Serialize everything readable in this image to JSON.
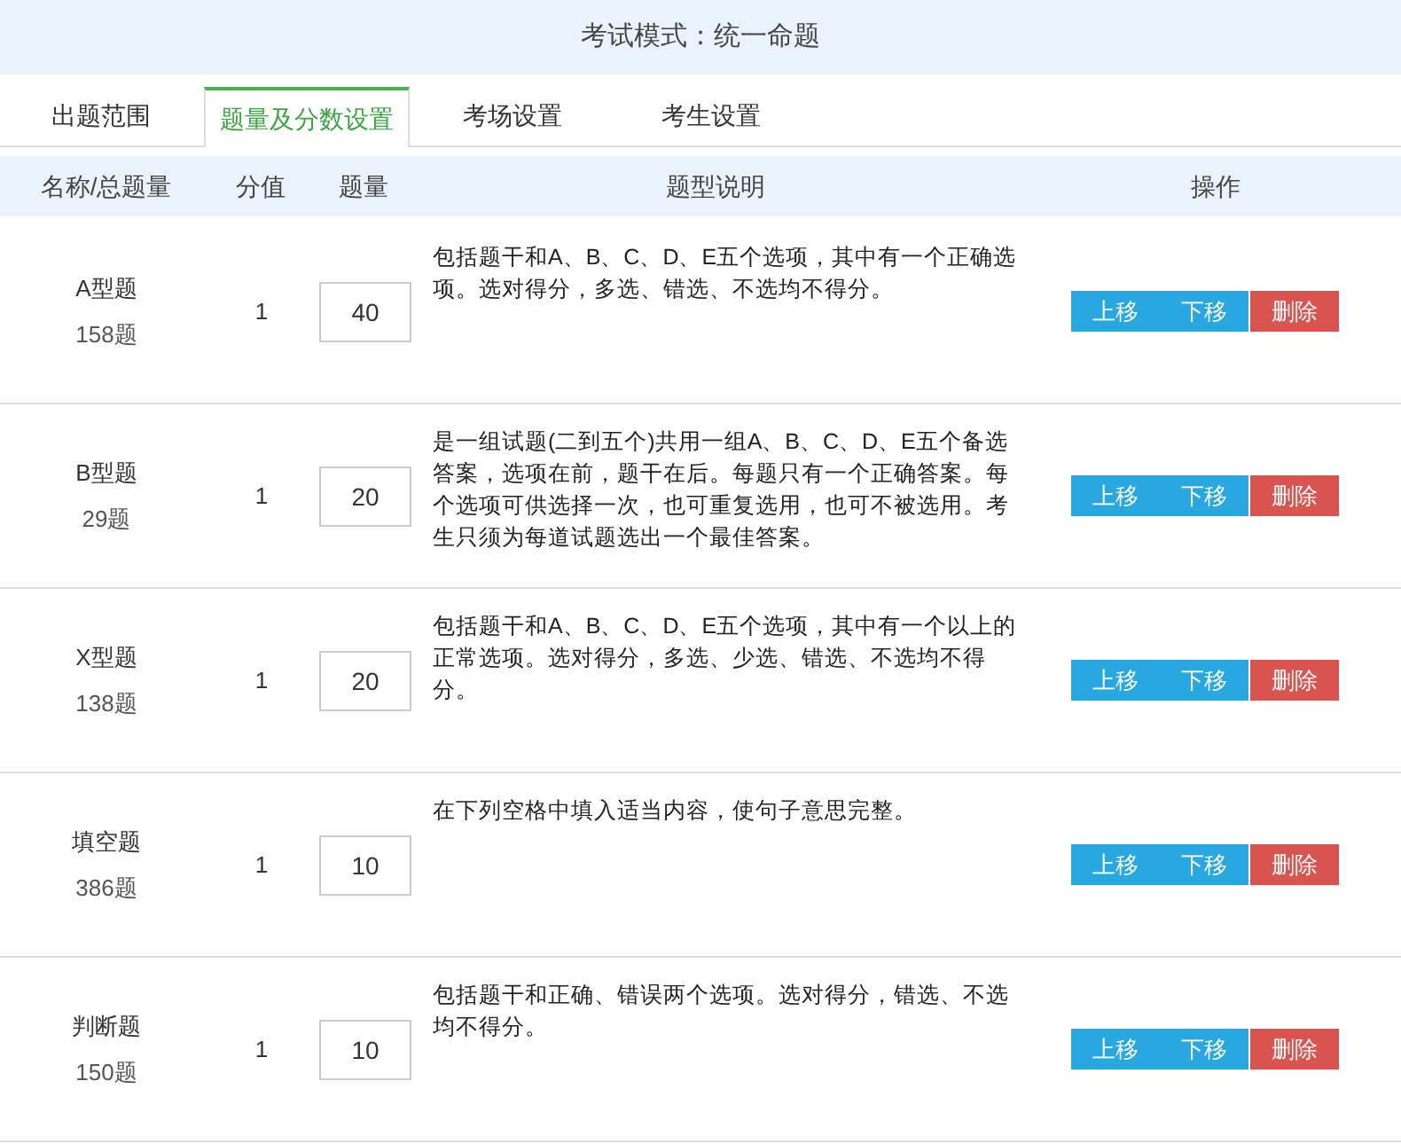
{
  "header": {
    "title": "考试模式：统一命题"
  },
  "tabs": [
    {
      "label": "出题范围",
      "selected": false
    },
    {
      "label": "题量及分数设置",
      "selected": true
    },
    {
      "label": "考场设置",
      "selected": false
    },
    {
      "label": "考生设置",
      "selected": false
    }
  ],
  "table": {
    "columns": [
      "名称/总题量",
      "分值",
      "题量",
      "题型说明",
      "操作"
    ],
    "rows": [
      {
        "name": "A型题",
        "total": "158题",
        "score": "1",
        "count": "40",
        "description": "包括题干和A、B、C、D、E五个选项，其中有一个正确选项。选对得分，多选、错选、不选均不得分。",
        "actions": [
          "上移",
          "下移",
          "删除"
        ]
      },
      {
        "name": "B型题",
        "total": "29题",
        "score": "1",
        "count": "20",
        "description": "是一组试题(二到五个)共用一组A、B、C、D、E五个备选答案，选项在前，题干在后。每题只有一个正确答案。每个选项可供选择一次，也可重复选用，也可不被选用。考生只须为每道试题选出一个最佳答案。",
        "actions": [
          "上移",
          "下移",
          "删除"
        ]
      },
      {
        "name": "X型题",
        "total": "138题",
        "score": "1",
        "count": "20",
        "description": "包括题干和A、B、C、D、E五个选项，其中有一个以上的正常选项。选对得分，多选、少选、错选、不选均不得分。",
        "actions": [
          "上移",
          "下移",
          "删除"
        ]
      },
      {
        "name": "填空题",
        "total": "386题",
        "score": "1",
        "count": "10",
        "description": "在下列空格中填入适当内容，使句子意思完整。",
        "actions": [
          "上移",
          "下移",
          "删除"
        ]
      },
      {
        "name": "判断题",
        "total": "150题",
        "score": "1",
        "count": "10",
        "description": "包括题干和正确、错误两个选项。选对得分，错选、不选均不得分。",
        "actions": [
          "上移",
          "下移",
          "删除"
        ]
      }
    ]
  }
}
